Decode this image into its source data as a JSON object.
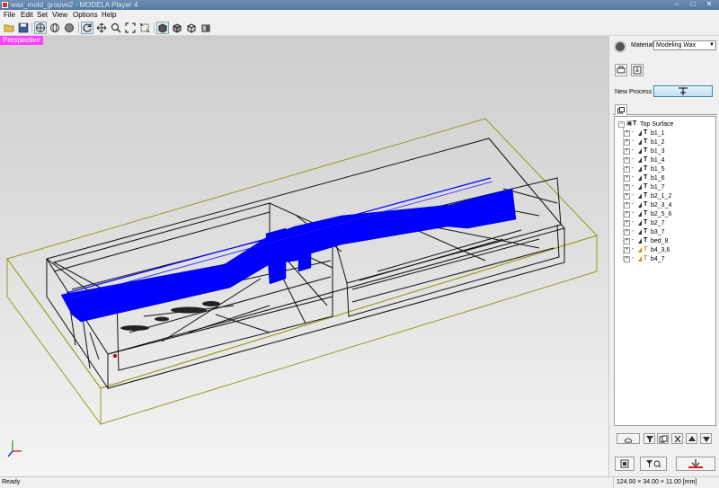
{
  "window": {
    "title": "wax_mold_groove2 - MODELA Player 4"
  },
  "menu": [
    "File",
    "Edit",
    "Set",
    "View",
    "Options",
    "Help"
  ],
  "toolbar": {
    "buttons": [
      "open-file",
      "save",
      "view-perspective",
      "view-rotate",
      "view-shade",
      "refresh",
      "pan",
      "zoom",
      "fit",
      "zoom-window",
      "render-solid",
      "render-box",
      "render-wire",
      "render-side"
    ]
  },
  "viewport": {
    "view_label": "Perspective",
    "toolpath_color": "#0000ff",
    "bounding_box_color": "#9a9a20"
  },
  "panel": {
    "material_label": "Material",
    "material_value": "Modeling Wax",
    "new_process_label": "New Process",
    "tree": {
      "root": "Top Surface",
      "items": [
        "b1_1",
        "b1_2",
        "b1_3",
        "b1_4",
        "b1_5",
        "b1_6",
        "b1_7",
        "b2_1_2",
        "b2_3_4",
        "b2_5_6",
        "b2_7",
        "b3_7",
        "bed_8",
        "b4_3,6",
        "b4_7"
      ]
    }
  },
  "status": {
    "text": "Ready",
    "dimensions": "124.00 × 34.00 × 11.00 [mm]"
  }
}
